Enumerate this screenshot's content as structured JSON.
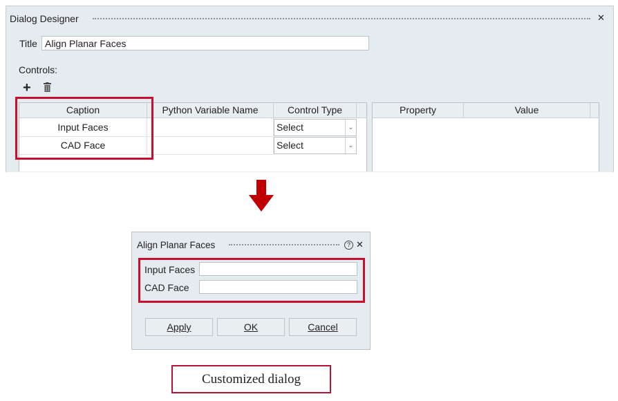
{
  "designer": {
    "title": "Dialog Designer",
    "close": "✕",
    "title_label": "Title",
    "title_value": "Align Planar Faces",
    "controls_label": "Controls:",
    "add_icon": "+",
    "delete_icon": "🗑",
    "columns": [
      "Caption",
      "Python Variable Name",
      "Control Type"
    ],
    "rows": [
      {
        "caption": "Input Faces",
        "var": "",
        "type": "Select"
      },
      {
        "caption": "CAD Face",
        "var": "",
        "type": "Select"
      }
    ],
    "prop_columns": [
      "Property",
      "Value"
    ]
  },
  "dialog": {
    "title": "Align Planar Faces",
    "help": "?",
    "close": "✕",
    "fields": [
      "Input Faces",
      "CAD Face"
    ],
    "buttons": [
      "Apply",
      "OK",
      "Cancel"
    ],
    "mnemonics": [
      "A",
      "O",
      "C"
    ]
  },
  "caption": "Customized dialog",
  "colors": {
    "highlight": "#c8102e",
    "arrow": "#c00000"
  }
}
